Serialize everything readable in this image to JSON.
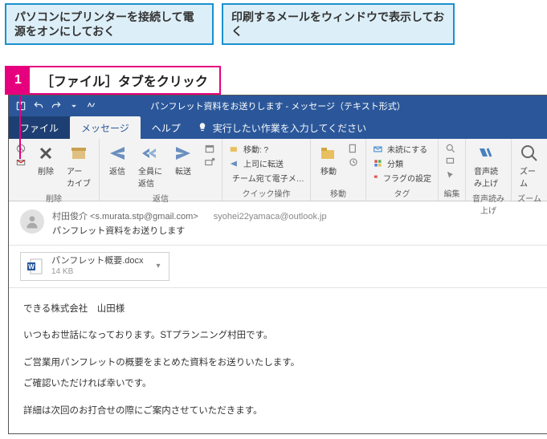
{
  "callouts": {
    "blue1": "パソコンにプリンターを接続して電源をオンにしておく",
    "blue2": "印刷するメールをウィンドウで表示しておく",
    "pink_num": "1",
    "pink_text": "［ファイル］タブをクリック"
  },
  "titlebar": {
    "title": "パンフレット資料をお送りします - メッセージ（テキスト形式）"
  },
  "tabs": {
    "file": "ファイル",
    "message": "メッセージ",
    "help": "ヘルプ",
    "tell_me": "実行したい作業を入力してください"
  },
  "ribbon": {
    "delete": {
      "label": "削除",
      "btn_delete": "削除",
      "btn_archive": "アー\nカイブ"
    },
    "respond": {
      "label": "返信",
      "btn_reply": "返信",
      "btn_replyall": "全員に\n返信",
      "btn_forward": "転送"
    },
    "quick": {
      "label": "クイック操作",
      "item1": "移動: ?",
      "item2": "上司に転送",
      "item3": "チーム宛て電子メ…"
    },
    "move": {
      "label": "移動",
      "btn": "移動"
    },
    "tag": {
      "label": "タグ",
      "item1": "未読にする",
      "item2": "分類",
      "item3": "フラグの設定"
    },
    "edit": {
      "label": "編集"
    },
    "speech": {
      "label": "音声読み上げ",
      "btn": "音声読\nみ上げ"
    },
    "zoom": {
      "label": "ズーム",
      "btn": "ズーム"
    }
  },
  "header": {
    "from": "村田俊介 <s.murata.stp@gmail.com>",
    "to": "syohei22yamaca@outlook.jp",
    "subject": "パンフレット資料をお送りします"
  },
  "attachment": {
    "name": "パンフレット概要.docx",
    "size": "14 KB"
  },
  "body": {
    "l1": "できる株式会社　山田様",
    "l2": "いつもお世話になっております。STプランニング村田です。",
    "l3": "ご営業用パンフレットの概要をまとめた資料をお送りいたします。",
    "l4": "ご確認いただければ幸いです。",
    "l5": "詳細は次回のお打合せの際にご案内させていただきます。"
  }
}
